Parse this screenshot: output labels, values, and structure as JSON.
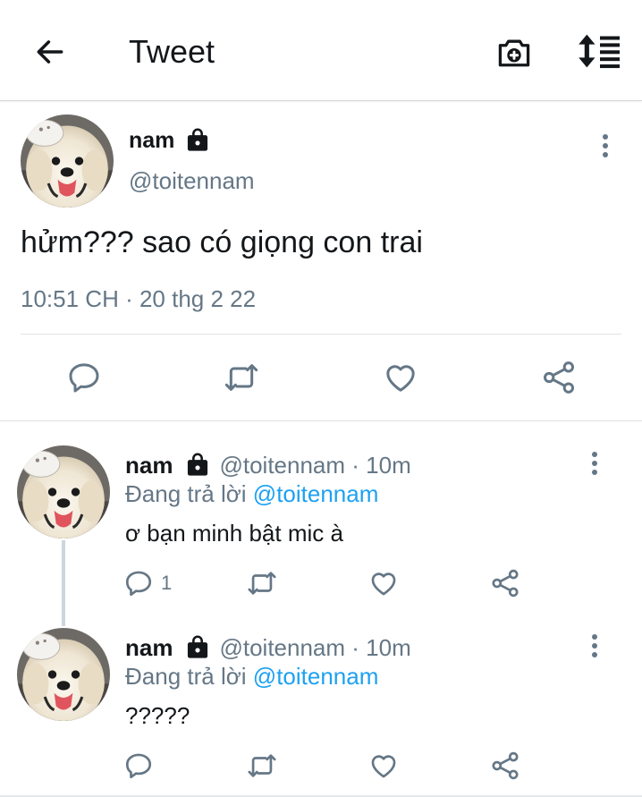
{
  "header": {
    "title": "Tweet",
    "back_icon": "arrow-left-icon",
    "camera_icon": "camera-plus-icon",
    "sort_icon": "sort-list-icon"
  },
  "main_tweet": {
    "name": "nam",
    "handle": "@toitennam",
    "text": "hửm??? sao có giọng con trai",
    "timestamp": "10:51 CH · 20 thg 2 22"
  },
  "replies": [
    {
      "name": "nam",
      "handle_time": "@toitennam · 10m",
      "replying_prefix": "Đang trả lời",
      "replying_to": "@toitennam",
      "text": "ơ bạn minh bật mic à",
      "reply_count": "1"
    },
    {
      "name": "nam",
      "handle_time": "@toitennam · 10m",
      "replying_prefix": "Đang trả lời",
      "replying_to": "@toitennam",
      "text": "?????",
      "reply_count": ""
    }
  ],
  "colors": {
    "accent": "#1da1f2",
    "muted": "#657786",
    "text": "#14171a"
  }
}
